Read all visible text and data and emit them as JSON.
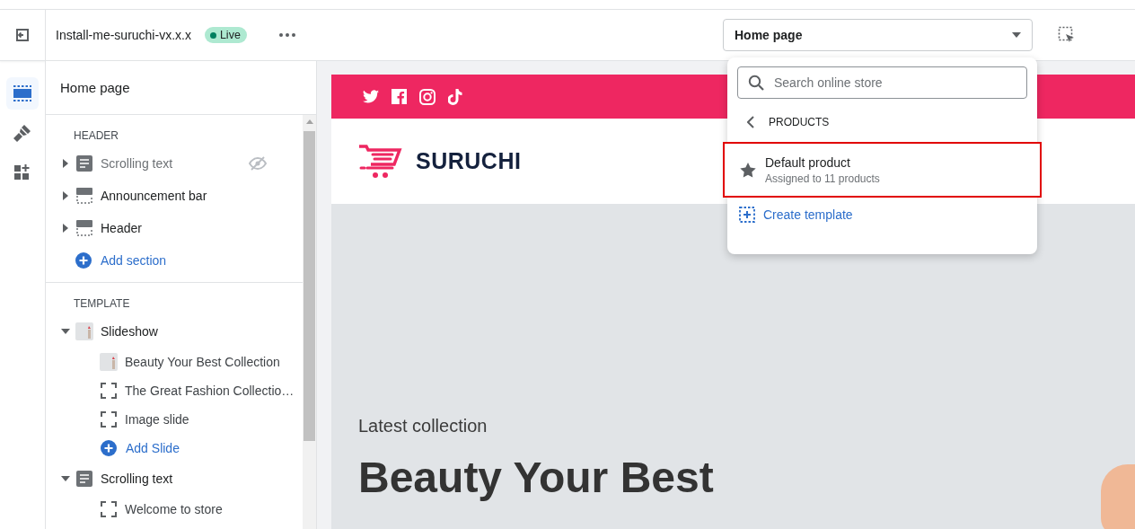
{
  "topbar": {
    "theme_name": "Install-me-suruchi-vx.x.x",
    "status": "Live",
    "template_select": "Home page"
  },
  "rail": [
    {
      "kind": "sections",
      "selected": true
    },
    {
      "kind": "brush",
      "selected": false
    },
    {
      "kind": "apps",
      "selected": false
    }
  ],
  "sidebar": {
    "title": "Home page",
    "groups": [
      {
        "heading": "HEADER",
        "add_label": "Add section",
        "sections": [
          {
            "label": "Scrolling text",
            "kind": "text",
            "hidden": true,
            "expanded": false
          },
          {
            "label": "Announcement bar",
            "kind": "bar",
            "hidden": false,
            "expanded": false
          },
          {
            "label": "Header",
            "kind": "bar",
            "hidden": false,
            "expanded": false
          }
        ]
      },
      {
        "heading": "TEMPLATE",
        "sections": [
          {
            "label": "Slideshow",
            "kind": "image",
            "hidden": false,
            "expanded": true,
            "children": [
              {
                "label": "Beauty Your Best Collection",
                "kind": "image"
              },
              {
                "label": "The Great Fashion Collectio…",
                "kind": "block"
              },
              {
                "label": "Image slide",
                "kind": "block"
              }
            ],
            "add_label": "Add Slide"
          },
          {
            "label": "Scrolling text",
            "kind": "text",
            "hidden": false,
            "expanded": true,
            "children": [
              {
                "label": "Welcome to store",
                "kind": "block"
              }
            ]
          }
        ]
      }
    ]
  },
  "preview": {
    "social": [
      {
        "kind": "twitter"
      },
      {
        "kind": "facebook"
      },
      {
        "kind": "instagram"
      },
      {
        "kind": "tiktok"
      }
    ],
    "logo": "SURUCHI",
    "hero": {
      "eyebrow": "Latest collection",
      "heading": "Beauty Your Best"
    }
  },
  "popover": {
    "search_placeholder": "Search online store",
    "category": "PRODUCTS",
    "templates": [
      {
        "title": "Default product",
        "subtitle": "Assigned to 11 products",
        "selected": true
      }
    ],
    "create_label": "Create template"
  }
}
